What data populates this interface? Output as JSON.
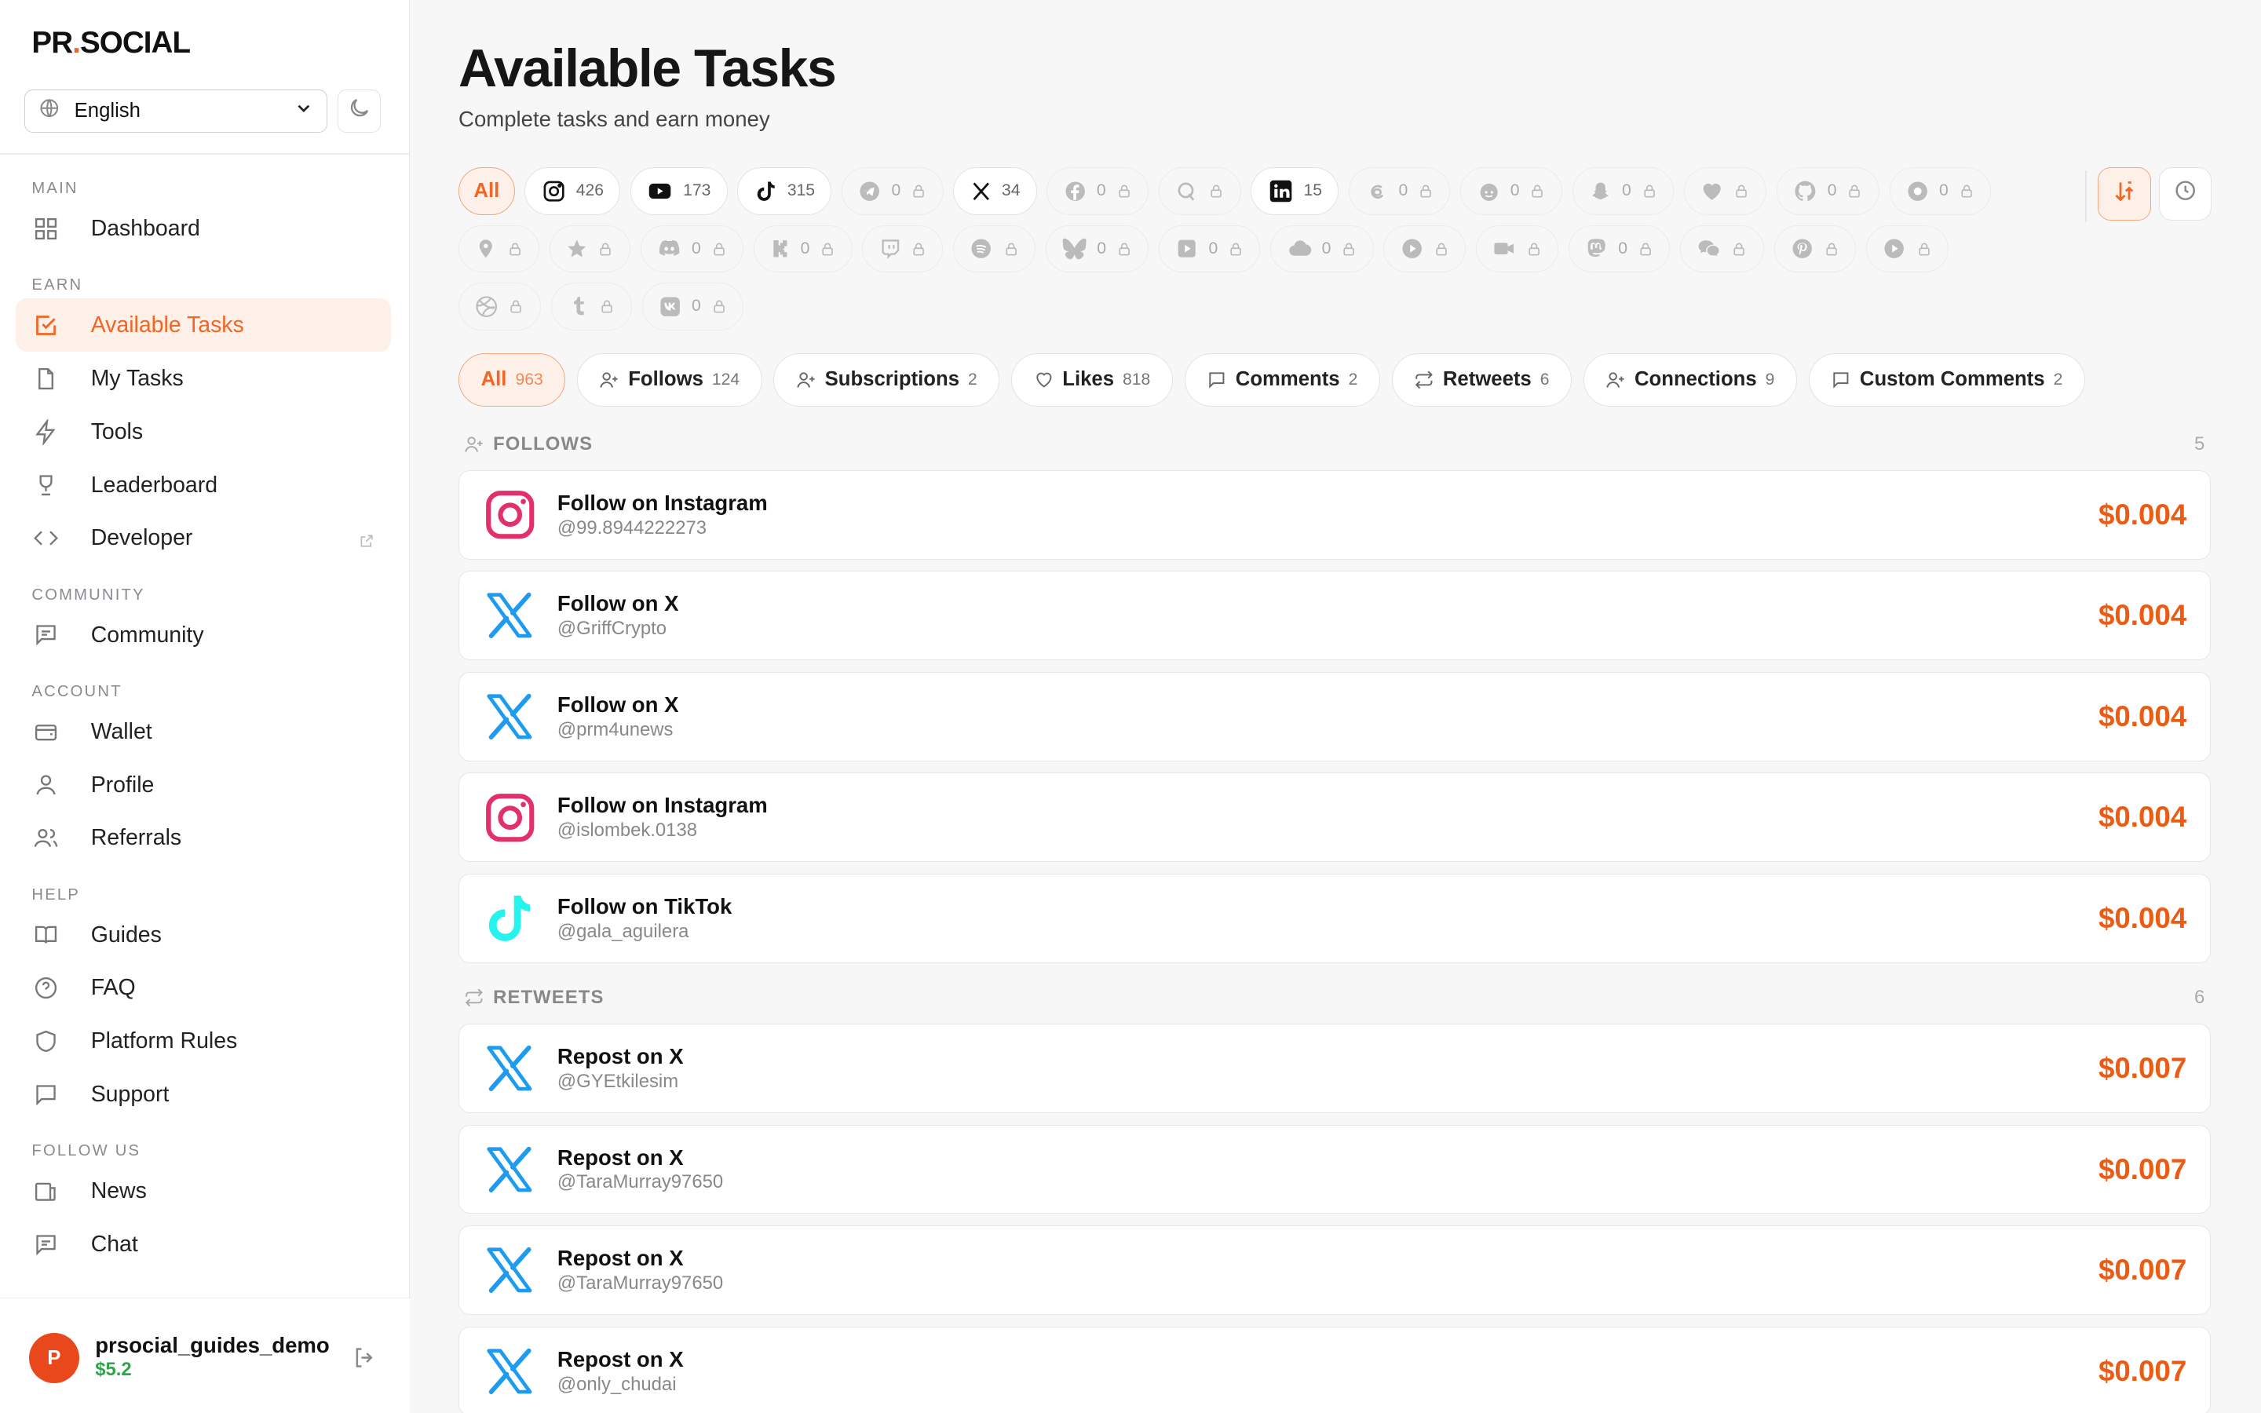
{
  "brand": {
    "logo_prefix": "PR",
    "logo_dot": ".",
    "logo_suffix": "SOCIAL"
  },
  "language": {
    "selected": "English"
  },
  "sidebar": {
    "sections": [
      {
        "title": "MAIN",
        "items": [
          {
            "label": "Dashboard",
            "icon": "grid-icon"
          }
        ]
      },
      {
        "title": "EARN",
        "items": [
          {
            "label": "Available Tasks",
            "icon": "checkbox-icon",
            "active": true
          },
          {
            "label": "My Tasks",
            "icon": "file-icon"
          },
          {
            "label": "Tools",
            "icon": "bolt-icon"
          },
          {
            "label": "Leaderboard",
            "icon": "trophy-icon"
          },
          {
            "label": "Developer",
            "icon": "code-icon",
            "external": true
          }
        ]
      },
      {
        "title": "COMMUNITY",
        "items": [
          {
            "label": "Community",
            "icon": "message-icon"
          }
        ]
      },
      {
        "title": "ACCOUNT",
        "items": [
          {
            "label": "Wallet",
            "icon": "wallet-icon"
          },
          {
            "label": "Profile",
            "icon": "user-icon"
          },
          {
            "label": "Referrals",
            "icon": "users-icon"
          }
        ]
      },
      {
        "title": "HELP",
        "items": [
          {
            "label": "Guides",
            "icon": "book-icon"
          },
          {
            "label": "FAQ",
            "icon": "question-icon"
          },
          {
            "label": "Platform Rules",
            "icon": "shield-icon"
          },
          {
            "label": "Support",
            "icon": "chat-icon"
          }
        ]
      },
      {
        "title": "FOLLOW US",
        "items": [
          {
            "label": "News",
            "icon": "newspaper-icon"
          },
          {
            "label": "Chat",
            "icon": "message-icon"
          }
        ]
      }
    ]
  },
  "user": {
    "initial": "P",
    "name": "prsocial_guides_demo",
    "balance": "$5.2"
  },
  "page": {
    "title": "Available Tasks",
    "subtitle": "Complete tasks and earn money"
  },
  "platform_filters": [
    {
      "key": "all",
      "label": "All",
      "active": true
    },
    {
      "key": "instagram",
      "count": "426"
    },
    {
      "key": "youtube",
      "count": "173"
    },
    {
      "key": "tiktok",
      "count": "315"
    },
    {
      "key": "telegram",
      "count": "0",
      "locked": true
    },
    {
      "key": "x",
      "count": "34"
    },
    {
      "key": "facebook",
      "count": "0",
      "locked": true
    },
    {
      "key": "quora",
      "count": "",
      "locked": true
    },
    {
      "key": "linkedin",
      "count": "15"
    },
    {
      "key": "threads",
      "count": "0",
      "locked": true
    },
    {
      "key": "reddit",
      "count": "0",
      "locked": true
    },
    {
      "key": "snapchat",
      "count": "0",
      "locked": true
    },
    {
      "key": "heart",
      "count": "",
      "locked": true
    },
    {
      "key": "github",
      "count": "0",
      "locked": true
    },
    {
      "key": "medium",
      "count": "0",
      "locked": true
    },
    {
      "key": "location",
      "count": "",
      "locked": true
    },
    {
      "key": "star",
      "count": "",
      "locked": true
    },
    {
      "key": "discord",
      "count": "0",
      "locked": true
    },
    {
      "key": "kick",
      "count": "0",
      "locked": true
    },
    {
      "key": "twitch",
      "count": "",
      "locked": true
    },
    {
      "key": "spotify",
      "count": "",
      "locked": true
    },
    {
      "key": "bluesky",
      "count": "0",
      "locked": true
    },
    {
      "key": "play",
      "count": "0",
      "locked": true
    },
    {
      "key": "cloud",
      "count": "0",
      "locked": true
    },
    {
      "key": "play-circle",
      "count": "",
      "locked": true
    },
    {
      "key": "video",
      "count": "",
      "locked": true
    },
    {
      "key": "mastodon",
      "count": "0",
      "locked": true
    },
    {
      "key": "wechat",
      "count": "",
      "locked": true
    },
    {
      "key": "pinterest",
      "count": "",
      "locked": true
    },
    {
      "key": "rumble",
      "count": "",
      "locked": true
    },
    {
      "key": "dribbble",
      "count": "",
      "locked": true
    },
    {
      "key": "tumblr",
      "count": "",
      "locked": true
    },
    {
      "key": "vk",
      "count": "0",
      "locked": true
    }
  ],
  "type_filters": [
    {
      "label": "All",
      "count": "963",
      "active": true
    },
    {
      "label": "Follows",
      "count": "124",
      "icon": "user-plus-icon"
    },
    {
      "label": "Subscriptions",
      "count": "2",
      "icon": "user-plus-icon"
    },
    {
      "label": "Likes",
      "count": "818",
      "icon": "heart-icon"
    },
    {
      "label": "Comments",
      "count": "2",
      "icon": "comment-icon"
    },
    {
      "label": "Retweets",
      "count": "6",
      "icon": "repeat-icon"
    },
    {
      "label": "Connections",
      "count": "9",
      "icon": "user-plus-icon"
    },
    {
      "label": "Custom Comments",
      "count": "2",
      "icon": "comment-icon"
    }
  ],
  "groups": [
    {
      "title": "FOLLOWS",
      "count": "5",
      "icon": "user-plus-icon",
      "tasks": [
        {
          "name": "Follow on Instagram",
          "handle": "@99.8944222273",
          "price": "$0.004",
          "platform": "instagram"
        },
        {
          "name": "Follow on X",
          "handle": "@GriffCrypto",
          "price": "$0.004",
          "platform": "x"
        },
        {
          "name": "Follow on X",
          "handle": "@prm4unews",
          "price": "$0.004",
          "platform": "x"
        },
        {
          "name": "Follow on Instagram",
          "handle": "@islombek.0138",
          "price": "$0.004",
          "platform": "instagram"
        },
        {
          "name": "Follow on TikTok",
          "handle": "@gala_aguilera",
          "price": "$0.004",
          "platform": "tiktok"
        }
      ]
    },
    {
      "title": "RETWEETS",
      "count": "6",
      "icon": "repeat-icon",
      "tasks": [
        {
          "name": "Repost on X",
          "handle": "@GYEtkilesim",
          "price": "$0.007",
          "platform": "x"
        },
        {
          "name": "Repost on X",
          "handle": "@TaraMurray97650",
          "price": "$0.007",
          "platform": "x"
        },
        {
          "name": "Repost on X",
          "handle": "@TaraMurray97650",
          "price": "$0.007",
          "platform": "x"
        },
        {
          "name": "Repost on X",
          "handle": "@only_chudai",
          "price": "$0.007",
          "platform": "x"
        }
      ]
    }
  ],
  "colors": {
    "accent": "#f26522",
    "price": "#ec5b13",
    "x_blue": "#1d9bf0",
    "instagram": "#e1306c",
    "tiktok": "#25f4ee",
    "balance": "#2aa748"
  }
}
